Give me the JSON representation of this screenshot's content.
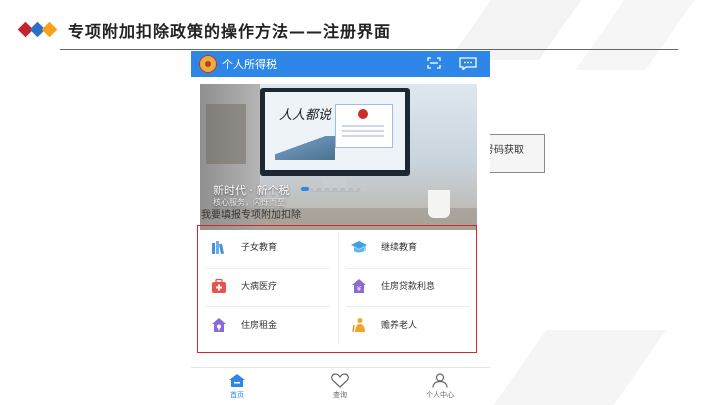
{
  "slide": {
    "title": "专项附加扣除政策的操作方法——注册界面"
  },
  "app": {
    "header_title": "个人所得税",
    "accent_color": "#2e86e8",
    "highlight_color": "#d4262b",
    "header_icons": [
      "scan-icon",
      "message-icon"
    ],
    "banner": {
      "headline": "新时代 · 新个税",
      "subtext": "核心服务，闪烁而至",
      "screen_text": "人人都说",
      "pagination": {
        "count": 8,
        "active_index": 0
      }
    },
    "section_heading": "我要填报专项附加扣除",
    "deductions": [
      {
        "label": "子女教育",
        "icon": "books-icon",
        "icon_color": "#4a90d9"
      },
      {
        "label": "继续教育",
        "icon": "graduation-cap-icon",
        "icon_color": "#3fa0e6"
      },
      {
        "label": "大病医疗",
        "icon": "medical-kit-icon",
        "icon_color": "#e5554f"
      },
      {
        "label": "住房贷款利息",
        "icon": "house-loan-icon",
        "icon_color": "#8c6bd6"
      },
      {
        "label": "住房租金",
        "icon": "house-rent-icon",
        "icon_color": "#8c6bd6"
      },
      {
        "label": "赡养老人",
        "icon": "elderly-person-icon",
        "icon_color": "#f1a627"
      }
    ],
    "tabs": [
      {
        "label": "首页",
        "icon": "home-icon",
        "active": true
      },
      {
        "label": "查询",
        "icon": "heart-icon",
        "active": false
      },
      {
        "label": "个人中心",
        "icon": "user-icon",
        "active": false
      }
    ]
  },
  "peek_label": "号码获取"
}
